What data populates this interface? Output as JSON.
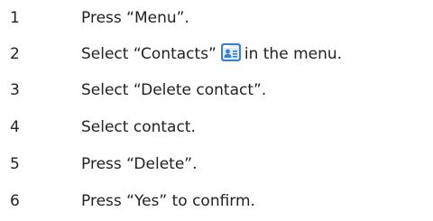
{
  "steps": [
    {
      "number": "1",
      "text": "Press “Menu”."
    },
    {
      "number": "2",
      "text_before": "Select “Contacts”",
      "icon": "contacts-icon",
      "text_after": "in the menu."
    },
    {
      "number": "3",
      "text": "Select “Delete contact”."
    },
    {
      "number": "4",
      "text": "Select contact."
    },
    {
      "number": "5",
      "text": "Press “Delete”."
    },
    {
      "number": "6",
      "text": "Press “Yes” to confirm."
    }
  ],
  "colors": {
    "text": "#222222",
    "icon_blue": "#3f7fc7",
    "icon_light": "#d9ecfb"
  }
}
